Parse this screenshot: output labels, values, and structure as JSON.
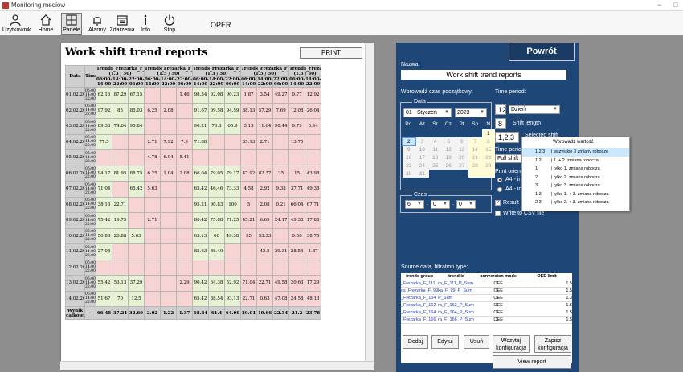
{
  "window": {
    "title": "Monitoring mediów",
    "controls": [
      "−",
      "□"
    ]
  },
  "toolbar": {
    "buttons": [
      {
        "label": "Użytkownik",
        "icon": "user-icon"
      },
      {
        "label": "Home",
        "icon": "home-icon"
      },
      {
        "label": "Panele",
        "icon": "panels-icon",
        "active": true
      },
      {
        "label": "Alarmy",
        "icon": "bell-icon"
      },
      {
        "label": "Zdarzenia",
        "icon": "calendar-icon"
      },
      {
        "label": "Info",
        "icon": "info-icon"
      },
      {
        "label": "Stop",
        "icon": "power-icon"
      }
    ],
    "status": "OPER"
  },
  "report": {
    "title": "Work shift trend reports",
    "print_label": "PRINT",
    "col_date": "Data",
    "col_time": "Time",
    "groups": [
      "Trends_Frezarka_F_111 (1.3 / 50)",
      "Trends_Frezarka_F_99 (1.5 / 50)",
      "Trends_Frezarka_F_154 (1.3 / 50)",
      "Trends_Frezarka_F_162 (1.5 / 50)",
      "Trends_Frezarka_ (1.5 / 50)"
    ],
    "shifts": [
      "06:00-14:00",
      "14:00-22:00",
      "22:00-06:00"
    ],
    "time_label": "06:00, 14:00, 22:00",
    "rows": [
      {
        "date": "01.02.2023",
        "cells": [
          "62.16",
          "87.29",
          "67.15",
          "",
          "",
          "1.46",
          "98.34",
          "92.08",
          "90.23",
          "1.87",
          "3.54",
          "49.27",
          "9.77",
          "12.92"
        ]
      },
      {
        "date": "02.02.2023",
        "cells": [
          "97.92",
          "85",
          "85.03",
          "6.25",
          "2.08",
          "",
          "91.67",
          "99.58",
          "94.59",
          "88.13",
          "57.29",
          "7.69",
          "12.08",
          "26.04"
        ]
      },
      {
        "date": "03.02.2023",
        "cells": [
          "89.38",
          "74.64",
          "95.84",
          "",
          "",
          "",
          "90.21",
          "76.3",
          "65.9",
          "3.13",
          "11.64",
          "90.44",
          "9.79",
          "8.94"
        ]
      },
      {
        "date": "04.02.2023",
        "cells": [
          "77.5",
          "",
          "",
          "2.71",
          "7.92",
          "7.9",
          "71.88",
          "",
          "",
          "35.13",
          "2.71",
          "",
          "13.75",
          ""
        ]
      },
      {
        "date": "05.02.2023",
        "cells": [
          "",
          "",
          "",
          "4.78",
          "6.04",
          "5.41",
          "",
          "",
          "",
          "",
          "",
          "",
          "",
          ""
        ]
      },
      {
        "date": "06.02.2023",
        "cells": [
          "94.17",
          "81.95",
          "88.75",
          "6.25",
          "1.04",
          "2.08",
          "66.04",
          "79.05",
          "79.17",
          "47.92",
          "82.37",
          "35",
          "15",
          "43.98"
        ]
      },
      {
        "date": "07.02.2023",
        "cells": [
          "71.04",
          "",
          "65.42",
          "5.63",
          "",
          "",
          "65.42",
          "46.46",
          "73.33",
          "4.58",
          "2.92",
          "9.38",
          "37.71",
          "49.38"
        ]
      },
      {
        "date": "08.02.2023",
        "cells": [
          "38.13",
          "22.71",
          "",
          "",
          "",
          "",
          "95.21",
          "90.83",
          "100",
          "5",
          "2.08",
          "0.21",
          "66.04",
          "67.71"
        ]
      },
      {
        "date": "09.02.2023",
        "cells": [
          "75.42",
          "19.75",
          "",
          "2.71",
          "",
          "",
          "80.42",
          "75.88",
          "71.25",
          "45.21",
          "6.65",
          "24.17",
          "49.38",
          "17.88"
        ]
      },
      {
        "date": "10.02.2023",
        "cells": [
          "50.83",
          "26.88",
          "5.63",
          "",
          "",
          "",
          "63.13",
          "60",
          "49.38",
          "55",
          "53.33",
          "",
          "9.58",
          "38.75"
        ]
      },
      {
        "date": "11.02.2023",
        "cells": [
          "27.08",
          "",
          "",
          "",
          "",
          "",
          "85.63",
          "86.49",
          "",
          "",
          "42.5",
          "29.31",
          "28.54",
          "1.87"
        ]
      },
      {
        "date": "12.02.2023",
        "cells": [
          "",
          "",
          "",
          "",
          "",
          "",
          "",
          "",
          "",
          "",
          "",
          "",
          "",
          ""
        ]
      },
      {
        "date": "13.02.2023",
        "cells": [
          "55.42",
          "53.13",
          "37.29",
          "",
          "",
          "2.29",
          "90.42",
          "64.38",
          "52.92",
          "71.04",
          "22.71",
          "49.58",
          "20.63",
          "17.29"
        ]
      },
      {
        "date": "14.02.2023",
        "cells": [
          "51.67",
          "70",
          "12.5",
          "",
          "",
          "",
          "65.42",
          "88.54",
          "93.13",
          "22.71",
          "0.63",
          "47.08",
          "24.58",
          "48.13"
        ]
      }
    ],
    "footer": {
      "label": "Wynik całkowity",
      "dash": "-",
      "cells": [
        "66.48",
        "37.24",
        "32.69",
        "2.02",
        "1.22",
        "1.37",
        "68.84",
        "61.4",
        "64.99",
        "30.01",
        "19.66",
        "22.34",
        "21.2",
        "23.78"
      ]
    }
  },
  "panel": {
    "back_label": "Powrót",
    "name_label": "Nazwa:",
    "name_value": "Work shift trend reports",
    "start_time_label": "Wprowadź czas początkowy:",
    "date_legend": "Data",
    "month_value": "01 - Styczeń",
    "year_value": "2023",
    "weekdays": [
      "Po",
      "Wt",
      "Śr",
      "Cz",
      "Pt",
      "So",
      "N"
    ],
    "calendar": [
      [
        {
          "d": "",
          "k": "h"
        },
        {
          "d": "",
          "k": "h"
        },
        {
          "d": "",
          "k": "h"
        },
        {
          "d": "",
          "k": "h"
        },
        {
          "d": "",
          "k": "h"
        },
        {
          "d": "",
          "k": "h"
        },
        {
          "d": "1",
          "k": "y"
        }
      ],
      [
        {
          "d": "2",
          "k": "sel"
        },
        {
          "d": "3",
          "k": "o"
        },
        {
          "d": "4",
          "k": "o"
        },
        {
          "d": "5",
          "k": "o"
        },
        {
          "d": "6",
          "k": "o"
        },
        {
          "d": "7",
          "k": "yo"
        },
        {
          "d": "8",
          "k": "yo"
        }
      ],
      [
        {
          "d": "9",
          "k": "o"
        },
        {
          "d": "10",
          "k": "o"
        },
        {
          "d": "11",
          "k": "o"
        },
        {
          "d": "12",
          "k": "o"
        },
        {
          "d": "13",
          "k": "o"
        },
        {
          "d": "14",
          "k": "yo"
        },
        {
          "d": "15",
          "k": "yo"
        }
      ],
      [
        {
          "d": "16",
          "k": "o"
        },
        {
          "d": "17",
          "k": "o"
        },
        {
          "d": "18",
          "k": "o"
        },
        {
          "d": "19",
          "k": "o"
        },
        {
          "d": "20",
          "k": "o"
        },
        {
          "d": "21",
          "k": "yo"
        },
        {
          "d": "22",
          "k": "yo"
        }
      ],
      [
        {
          "d": "23",
          "k": "o"
        },
        {
          "d": "24",
          "k": "o"
        },
        {
          "d": "25",
          "k": "o"
        },
        {
          "d": "26",
          "k": "o"
        },
        {
          "d": "27",
          "k": "o"
        },
        {
          "d": "28",
          "k": "yo"
        },
        {
          "d": "29",
          "k": "yo"
        }
      ],
      [
        {
          "d": "30",
          "k": "o"
        },
        {
          "d": "31",
          "k": "o"
        },
        {
          "d": "",
          "k": "h"
        },
        {
          "d": "",
          "k": "h"
        },
        {
          "d": "",
          "k": "h"
        },
        {
          "d": "",
          "k": "yo"
        },
        {
          "d": "",
          "k": "yo"
        }
      ]
    ],
    "time_legend": "Czas",
    "hour_value": "6",
    "minute_value": "0",
    "second_value": "0",
    "colon": ":",
    "period_label": "Time period:",
    "period_num": "12",
    "period_unit": "Dzień",
    "shift_length_value": "8",
    "shift_length_label": "Shift length",
    "selected_shift_value": "1,2,3",
    "selected_shift_label": "Selected shift",
    "time_period_short": "Time perio",
    "full_shift": "Full shift",
    "print_orient_label": "Print orienta",
    "a4_1": "A4 - in",
    "a4_2": "A4 - in",
    "result_label": "Result o",
    "csv_label": "Write to CSV file",
    "source_label": "Source data, filtration type:",
    "src_headers": [
      "trends group",
      "trend id",
      "conversion mode",
      "OEE limit"
    ],
    "src_rows": [
      [
        "_Frezarka_F_111",
        "ra_F_111_P_Sum",
        "OEE",
        "1.5"
      ],
      [
        "ds_Frezarka_F_99",
        "ka_F_99_P_Sum",
        "OEE",
        "1.5"
      ],
      [
        "_Frezarka_F_154",
        "P_Sum",
        "OEE",
        "1.3"
      ],
      [
        "_Frezarka_F_162",
        "ra_F_162_P_Sum",
        "OEE",
        "1.5"
      ],
      [
        "_Frezarka_F_164",
        "ra_F_164_P_Sum",
        "OEE",
        "1.5"
      ],
      [
        "_Frezarka_F_166",
        "ra_F_166_P_Sum",
        "OEE",
        "1.5"
      ]
    ],
    "btn_add": "Dodaj",
    "btn_edit": "Edytuj",
    "btn_delete": "Usuń",
    "btn_load": "Wczytaj konfiguracja",
    "btn_save": "Zapisz konfiguracja",
    "btn_view": "View report"
  },
  "shift_popup": {
    "header": "Wprowadź wartość",
    "options": [
      {
        "value": "1,2,3",
        "label": "| wszystkie 3 zmiany robocze",
        "selected": true
      },
      {
        "value": "1,2",
        "label": "| 1. + 2. zmiana robocza"
      },
      {
        "value": "1",
        "label": "| tylko 1. zmiana robocza"
      },
      {
        "value": "2",
        "label": "| tylko 2. zmiana robocza"
      },
      {
        "value": "3",
        "label": "| tylko 3. zmiana robocza"
      },
      {
        "value": "1,3",
        "label": "| tylko 1. + 3. zmiana robocza"
      },
      {
        "value": "2,3",
        "label": "| tylko 2. + 3. zmiana robocza"
      }
    ]
  }
}
